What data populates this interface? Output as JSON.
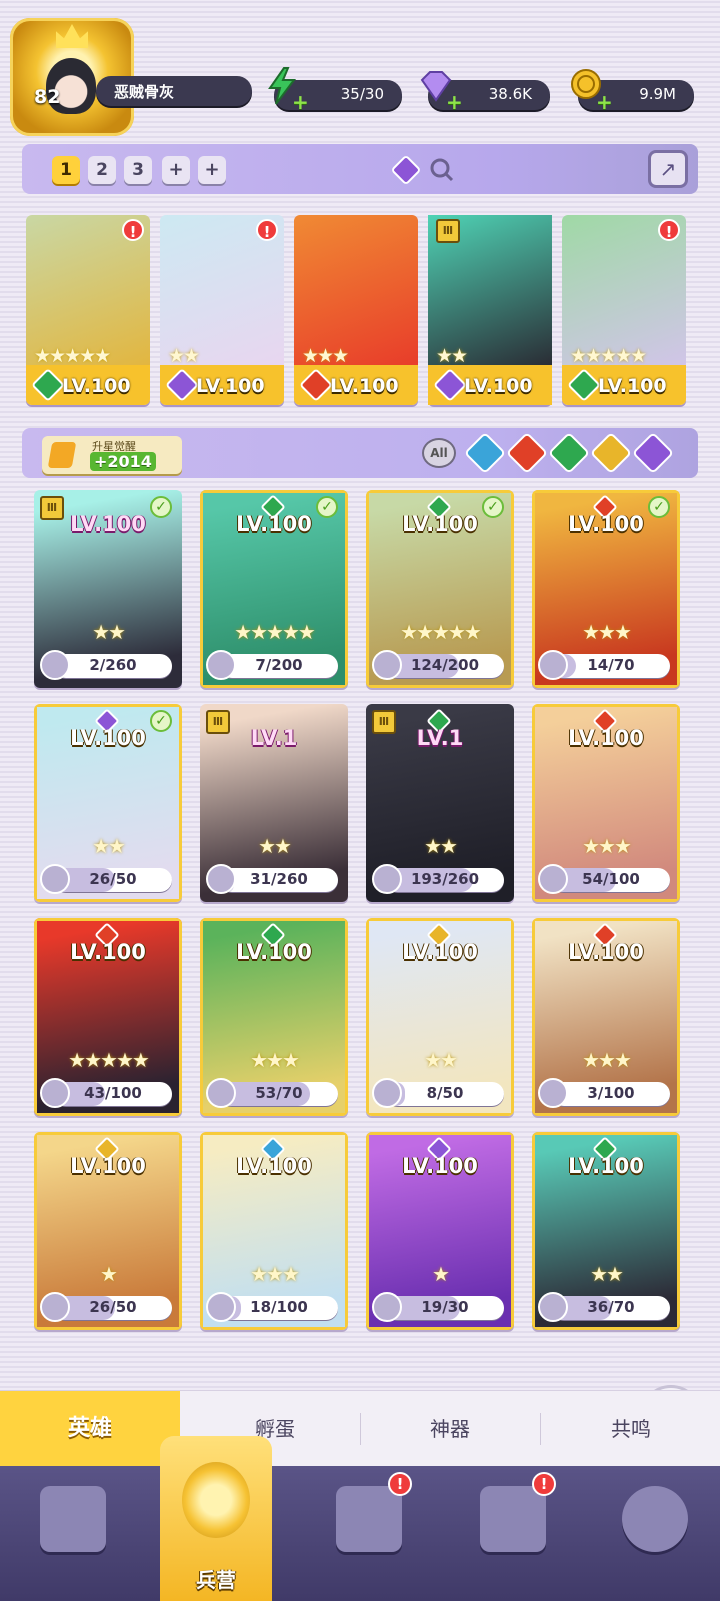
{
  "player": {
    "level": "82",
    "name": "恶贼骨灰"
  },
  "resources": [
    {
      "name": "energy",
      "value": "35/30",
      "color": "#39c45a",
      "icon": "lightning-icon"
    },
    {
      "name": "gems",
      "value": "38.6K",
      "color": "#b38cf0",
      "icon": "diamond-icon"
    },
    {
      "name": "gold",
      "value": "9.9M",
      "color": "#f5c12a",
      "icon": "coin-icon"
    }
  ],
  "team_slots": [
    "1",
    "2",
    "3",
    "+",
    "+"
  ],
  "team": [
    {
      "level": "LV.100",
      "stars": "★★★★★",
      "element": "#2ea84f",
      "alert": "!",
      "shield": "",
      "art": [
        "#c9d7a4",
        "#e2b640"
      ]
    },
    {
      "level": "LV.100",
      "stars": "★★",
      "element": "#8c55d6",
      "alert": "!",
      "shield": "",
      "art": [
        "#cde9f2",
        "#e8d6f0"
      ]
    },
    {
      "level": "LV.100",
      "stars": "★★★",
      "element": "#e04027",
      "alert": "",
      "shield": "",
      "art": [
        "#f08a34",
        "#e83d2a"
      ]
    },
    {
      "level": "LV.100",
      "stars": "★★",
      "element": "#8c55d6",
      "alert": "",
      "shield": "Ⅲ",
      "art": [
        "#4fd3b5",
        "#2a2d35"
      ]
    },
    {
      "level": "LV.100",
      "stars": "★★★★★",
      "element": "#2ea84f",
      "alert": "!",
      "shield": "",
      "art": [
        "#9fd9a5",
        "#d1c5e8"
      ]
    }
  ],
  "awaken": {
    "label": "升星觉醒",
    "value": "+2014"
  },
  "filters": [
    {
      "name": "all",
      "label": "All",
      "color": "#d8d4e2"
    },
    {
      "name": "water",
      "color": "#3aa4d9"
    },
    {
      "name": "fire",
      "color": "#e04027"
    },
    {
      "name": "wood",
      "color": "#2ea84f"
    },
    {
      "name": "light",
      "color": "#e8b52a"
    },
    {
      "name": "dark",
      "color": "#8c55d6"
    }
  ],
  "heroes": [
    {
      "level": "LV.100",
      "pink": true,
      "progress": "2/260",
      "ratio": 0.01,
      "stars": "★★",
      "element": "",
      "check": true,
      "shield": "Ⅲ",
      "art": [
        "#a7f0e7",
        "#2d2c3a"
      ]
    },
    {
      "level": "LV.100",
      "pink": false,
      "progress": "7/200",
      "ratio": 0.04,
      "stars": "★★★★★",
      "element": "#2ea84f",
      "check": true,
      "shield": "",
      "art": [
        "#56c7a8",
        "#2e8f6b"
      ]
    },
    {
      "level": "LV.100",
      "pink": false,
      "progress": "124/200",
      "ratio": 0.62,
      "stars": "★★★★★",
      "element": "#2ea84f",
      "check": true,
      "shield": "",
      "art": [
        "#c7d9a6",
        "#b89b52"
      ]
    },
    {
      "level": "LV.100",
      "pink": false,
      "progress": "14/70",
      "ratio": 0.2,
      "stars": "★★★",
      "element": "#e04027",
      "check": true,
      "shield": "",
      "art": [
        "#f0b640",
        "#c8381f"
      ]
    },
    {
      "level": "LV.100",
      "pink": false,
      "progress": "26/50",
      "ratio": 0.52,
      "stars": "★★",
      "element": "#8c55d6",
      "check": true,
      "shield": "",
      "art": [
        "#bfe9ef",
        "#e2dcef"
      ]
    },
    {
      "level": "LV.1",
      "pink": true,
      "progress": "31/260",
      "ratio": 0.12,
      "stars": "★★",
      "element": "",
      "check": false,
      "shield": "Ⅲ",
      "art": [
        "#f0d8c8",
        "#3b2f38"
      ]
    },
    {
      "level": "LV.1",
      "pink": true,
      "progress": "193/260",
      "ratio": 0.74,
      "stars": "★★",
      "element": "#2ea84f",
      "check": false,
      "shield": "Ⅲ",
      "art": [
        "#3a3a46",
        "#1f1f28"
      ]
    },
    {
      "level": "LV.100",
      "pink": false,
      "progress": "54/100",
      "ratio": 0.54,
      "stars": "★★★",
      "element": "#e04027",
      "check": false,
      "shield": "",
      "art": [
        "#f4cf9a",
        "#d1897d"
      ]
    },
    {
      "level": "LV.100",
      "pink": false,
      "progress": "43/100",
      "ratio": 0.43,
      "stars": "★★★★★",
      "element": "#e04027",
      "check": false,
      "shield": "",
      "art": [
        "#e8392a",
        "#2a2230"
      ]
    },
    {
      "level": "LV.100",
      "pink": false,
      "progress": "53/70",
      "ratio": 0.76,
      "stars": "★★★",
      "element": "#2ea84f",
      "check": false,
      "shield": "",
      "art": [
        "#5bb35b",
        "#e6d06a"
      ]
    },
    {
      "level": "LV.100",
      "pink": false,
      "progress": "8/50",
      "ratio": 0.16,
      "stars": "★★",
      "element": "#e8b52a",
      "check": false,
      "shield": "",
      "art": [
        "#dfe7f4",
        "#f2e6c0"
      ]
    },
    {
      "level": "LV.100",
      "pink": false,
      "progress": "3/100",
      "ratio": 0.03,
      "stars": "★★★",
      "element": "#e04027",
      "check": false,
      "shield": "",
      "art": [
        "#f1e2c4",
        "#b3744a"
      ]
    },
    {
      "level": "LV.100",
      "pink": false,
      "progress": "26/50",
      "ratio": 0.52,
      "stars": "★",
      "element": "#e8b52a",
      "check": false,
      "shield": "",
      "art": [
        "#f4d68a",
        "#c97a3a"
      ]
    },
    {
      "level": "LV.100",
      "pink": false,
      "progress": "18/100",
      "ratio": 0.18,
      "stars": "★★★",
      "element": "#3aa4d9",
      "check": false,
      "shield": "",
      "art": [
        "#f6ecc2",
        "#c2dff0"
      ]
    },
    {
      "level": "LV.100",
      "pink": false,
      "progress": "19/30",
      "ratio": 0.63,
      "stars": "★",
      "element": "#8c55d6",
      "check": false,
      "shield": "",
      "art": [
        "#c06be4",
        "#6a2fb0"
      ]
    },
    {
      "level": "LV.100",
      "pink": false,
      "progress": "36/70",
      "ratio": 0.51,
      "stars": "★★",
      "element": "#2ea84f",
      "check": false,
      "shield": "",
      "art": [
        "#58c9b6",
        "#2c2a36"
      ]
    }
  ],
  "tabs": [
    "英雄",
    "孵蛋",
    "神器",
    "共鸣"
  ],
  "nav": {
    "active_label": "兵营",
    "badge": "!"
  }
}
